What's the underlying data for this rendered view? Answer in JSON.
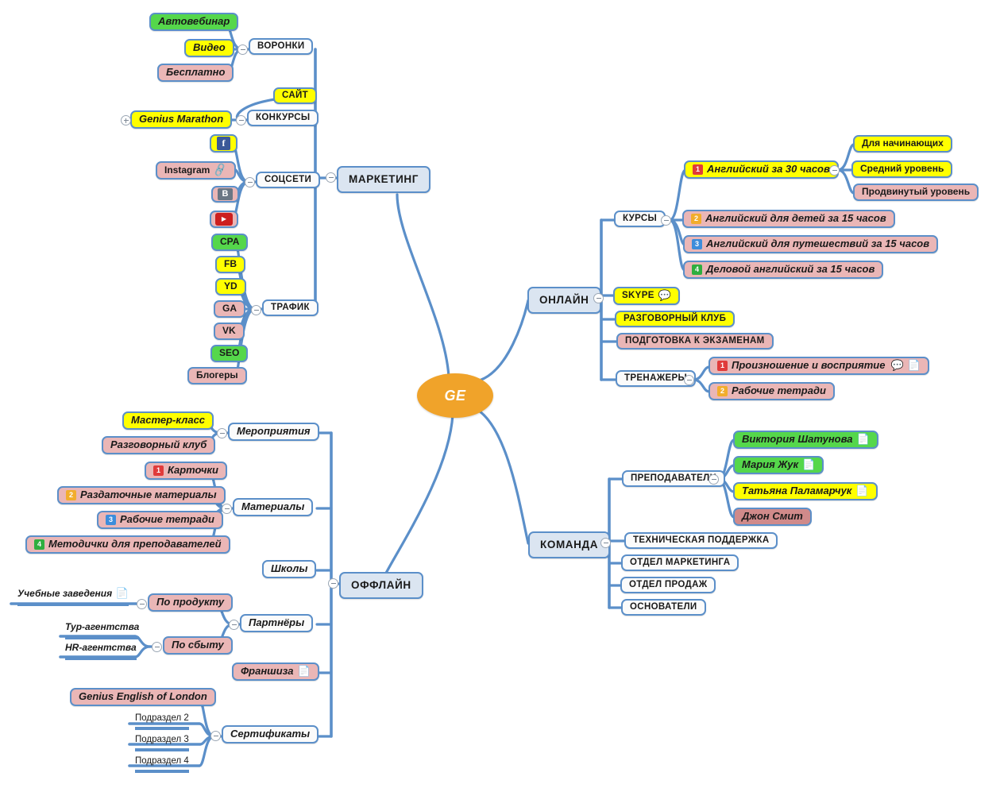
{
  "diagram": {
    "type": "mind-map",
    "root": {
      "label": "GE"
    },
    "main_branches": [
      "МАРКЕТИНГ",
      "ОНЛАЙН",
      "ОФФЛАЙН",
      "КОМАНДА"
    ]
  },
  "marketing": {
    "label": "МАРКЕТИНГ",
    "groups": [
      {
        "label": "ВОРОНКИ",
        "children": [
          "Автовебинар",
          "Видео",
          "Бесплатно"
        ]
      },
      {
        "label": "КОНКУРСЫ",
        "children": [
          "САЙТ",
          "Genius Marathon"
        ]
      },
      {
        "label": "СОЦСЕТИ",
        "children": [
          "Facebook",
          "Instagram",
          "ВКонтакте",
          "YouTube"
        ]
      },
      {
        "label": "ТРАФИК",
        "children": [
          "CPA",
          "FB",
          "YD",
          "GA",
          "VK",
          "SEO",
          "Блогеры"
        ]
      }
    ],
    "funnels": {
      "autowebinar": "Автовебинар",
      "video": "Видео",
      "free": "Бесплатно",
      "label": "ВОРОНКИ"
    },
    "contests": {
      "site": "САЙТ",
      "marathon": "Genius Marathon",
      "label": "КОНКУРСЫ"
    },
    "social": {
      "label": "СОЦСЕТИ",
      "instagram": "Instagram",
      "vk_glyph": "B",
      "fb_glyph": "f",
      "yt_glyph": "▶"
    },
    "traffic": {
      "label": "ТРАФИК",
      "cpa": "CPA",
      "fb": "FB",
      "yd": "YD",
      "ga": "GA",
      "vk": "VK",
      "seo": "SEO",
      "bloggers": "Блогеры"
    }
  },
  "online": {
    "label": "ОНЛАЙН",
    "courses": {
      "label": "КУРСЫ",
      "items": [
        {
          "num": "1",
          "label": "Английский за 30 часов"
        },
        {
          "num": "2",
          "label": "Английский для детей за 15 часов"
        },
        {
          "num": "3",
          "label": "Английский для путешествий за 15 часов"
        },
        {
          "num": "4",
          "label": "Деловой английский за 15 часов"
        }
      ],
      "levels": [
        "Для начинающих",
        "Средний уровень",
        "Продвинутый уровень"
      ]
    },
    "skype": "SKYPE",
    "speaking_club": "РАЗГОВОРНЫЙ КЛУБ",
    "exam_prep": "ПОДГОТОВКА К ЭКЗАМЕНАМ",
    "trainers": {
      "label": "ТРЕНАЖЕРЫ",
      "items": [
        {
          "num": "1",
          "label": "Произношение и восприятие"
        },
        {
          "num": "2",
          "label": "Рабочие тетради"
        }
      ]
    }
  },
  "offline": {
    "label": "ОФФЛАЙН",
    "events": {
      "label": "Мероприятия",
      "children": [
        "Мастер-класс",
        "Разговорный клуб"
      ]
    },
    "materials": {
      "label": "Материалы",
      "items": [
        {
          "num": "1",
          "label": "Карточки"
        },
        {
          "num": "2",
          "label": "Раздаточные материалы"
        },
        {
          "num": "3",
          "label": "Рабочие тетради"
        },
        {
          "num": "4",
          "label": "Методички для преподавателей"
        }
      ]
    },
    "schools": "Школы",
    "partners": {
      "label": "Партнёры",
      "by_product": {
        "label": "По продукту",
        "children": [
          "Учебные заведения"
        ]
      },
      "by_sales": {
        "label": "По сбыту",
        "children": [
          "Тур-агентства",
          "HR-агентства"
        ]
      }
    },
    "franchise": "Франшиза",
    "certificates": {
      "label": "Сертификаты",
      "children": [
        "Genius English of London",
        "Подраздел 2",
        "Подраздел 3",
        "Подраздел 4"
      ]
    }
  },
  "team": {
    "label": "КОМАНДА",
    "teachers": {
      "label": "ПРЕПОДАВАТЕЛИ",
      "members": [
        "Виктория Шатунова",
        "Мария Жук",
        "Татьяна Паламарчук",
        "Джон Смит"
      ]
    },
    "departments": [
      "ТЕХНИЧЕСКАЯ ПОДДЕРЖКА",
      "ОТДЕЛ МАРКЕТИНГА",
      "ОТДЕЛ ПРОДАЖ",
      "ОСНОВАТЕЛИ"
    ]
  },
  "colors": {
    "branch_line": "#5B8FC9",
    "root_fill": "#f0a32a",
    "node_blue": "#dbe5f1",
    "node_yellow": "#ffff00",
    "node_pink": "#eab6b6",
    "node_green": "#55d74b",
    "node_rose": "#d08a8a"
  }
}
